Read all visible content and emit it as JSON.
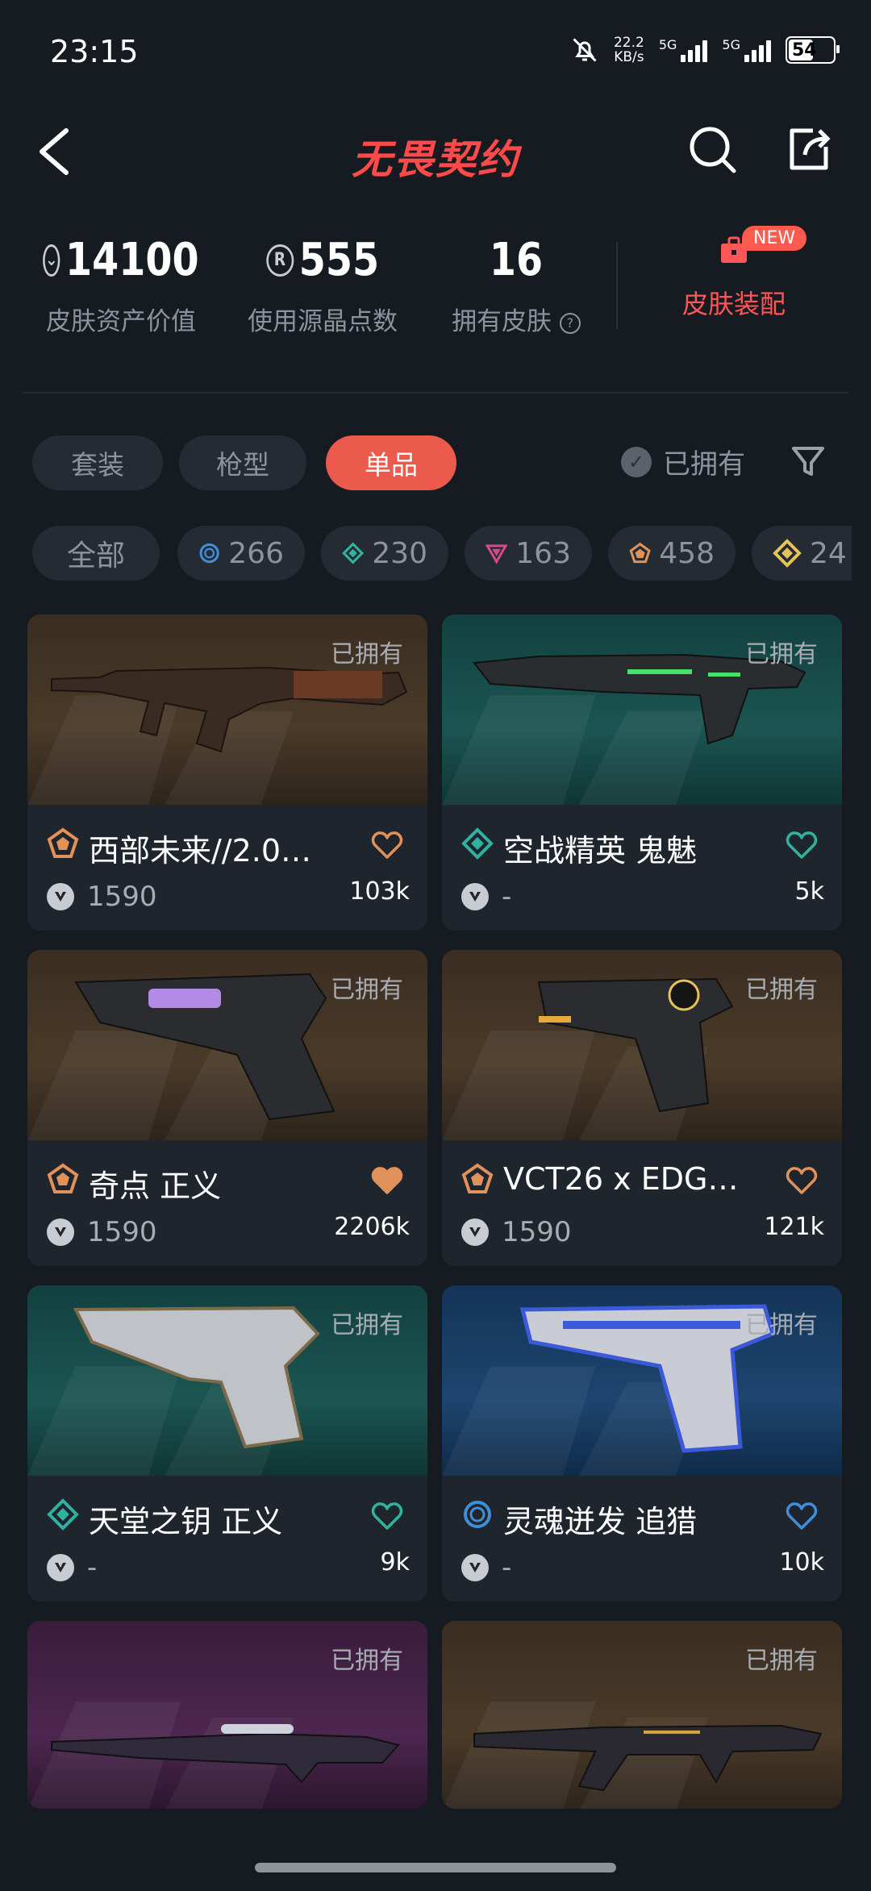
{
  "status": {
    "time": "23:15",
    "net_speed": "22.2",
    "net_unit": "KB/s",
    "sig1": "5G",
    "sig2": "5G",
    "battery": "54"
  },
  "header": {
    "title": "无畏契约"
  },
  "stats": [
    {
      "value": "14100",
      "label": "皮肤资产价值",
      "icon": "valorant-points-icon"
    },
    {
      "value": "555",
      "label": "使用源晶点数",
      "icon": "radianite-icon"
    },
    {
      "value": "16",
      "label": "拥有皮肤",
      "icon": "help-icon"
    }
  ],
  "equip": {
    "label": "皮肤装配",
    "badge": "NEW"
  },
  "tabs": [
    {
      "label": "套装",
      "active": false
    },
    {
      "label": "枪型",
      "active": false
    },
    {
      "label": "单品",
      "active": true
    }
  ],
  "owned_filter": {
    "label": "已拥有"
  },
  "chips": [
    {
      "label": "全部"
    },
    {
      "count": "266",
      "tier": "select",
      "color": "#3f8fd8"
    },
    {
      "count": "230",
      "tier": "deluxe",
      "color": "#2fb3a0"
    },
    {
      "count": "163",
      "tier": "premium",
      "color": "#d6498a"
    },
    {
      "count": "458",
      "tier": "exclusive",
      "color": "#e0925a"
    },
    {
      "count": "24",
      "tier": "ultra",
      "color": "#e6c25a"
    }
  ],
  "cards": [
    {
      "name": "西部未来//2.0…",
      "price": "1590",
      "likes": "103k",
      "owned": "已拥有",
      "tier": "exclusive",
      "tier_color": "#e0925a",
      "heart_color": "#e0925a",
      "heart_filled": false,
      "bg": "brown"
    },
    {
      "name": "空战精英 鬼魅",
      "price": "-",
      "likes": "5k",
      "owned": "已拥有",
      "tier": "deluxe",
      "tier_color": "#2fb3a0",
      "heart_color": "#2fb3a0",
      "heart_filled": false,
      "bg": "teal"
    },
    {
      "name": "奇点 正义",
      "price": "1590",
      "likes": "2206k",
      "owned": "已拥有",
      "tier": "exclusive",
      "tier_color": "#e0925a",
      "heart_color": "#e0925a",
      "heart_filled": true,
      "bg": "brown"
    },
    {
      "name": "VCT26 x EDG…",
      "price": "1590",
      "likes": "121k",
      "owned": "已拥有",
      "tier": "exclusive",
      "tier_color": "#e0925a",
      "heart_color": "#e0925a",
      "heart_filled": false,
      "bg": "brown"
    },
    {
      "name": "天堂之钥 正义",
      "price": "-",
      "likes": "9k",
      "owned": "已拥有",
      "tier": "deluxe",
      "tier_color": "#2fb3a0",
      "heart_color": "#2fb3a0",
      "heart_filled": false,
      "bg": "teal"
    },
    {
      "name": "灵魂迸发 追猎",
      "price": "-",
      "likes": "10k",
      "owned": "已拥有",
      "tier": "select",
      "tier_color": "#3f8fd8",
      "heart_color": "#3f8fd8",
      "heart_filled": false,
      "bg": "blue"
    },
    {
      "name": "",
      "price": "",
      "likes": "",
      "owned": "已拥有",
      "bg": "purple"
    },
    {
      "name": "",
      "price": "",
      "likes": "",
      "owned": "已拥有",
      "bg": "brown"
    }
  ]
}
